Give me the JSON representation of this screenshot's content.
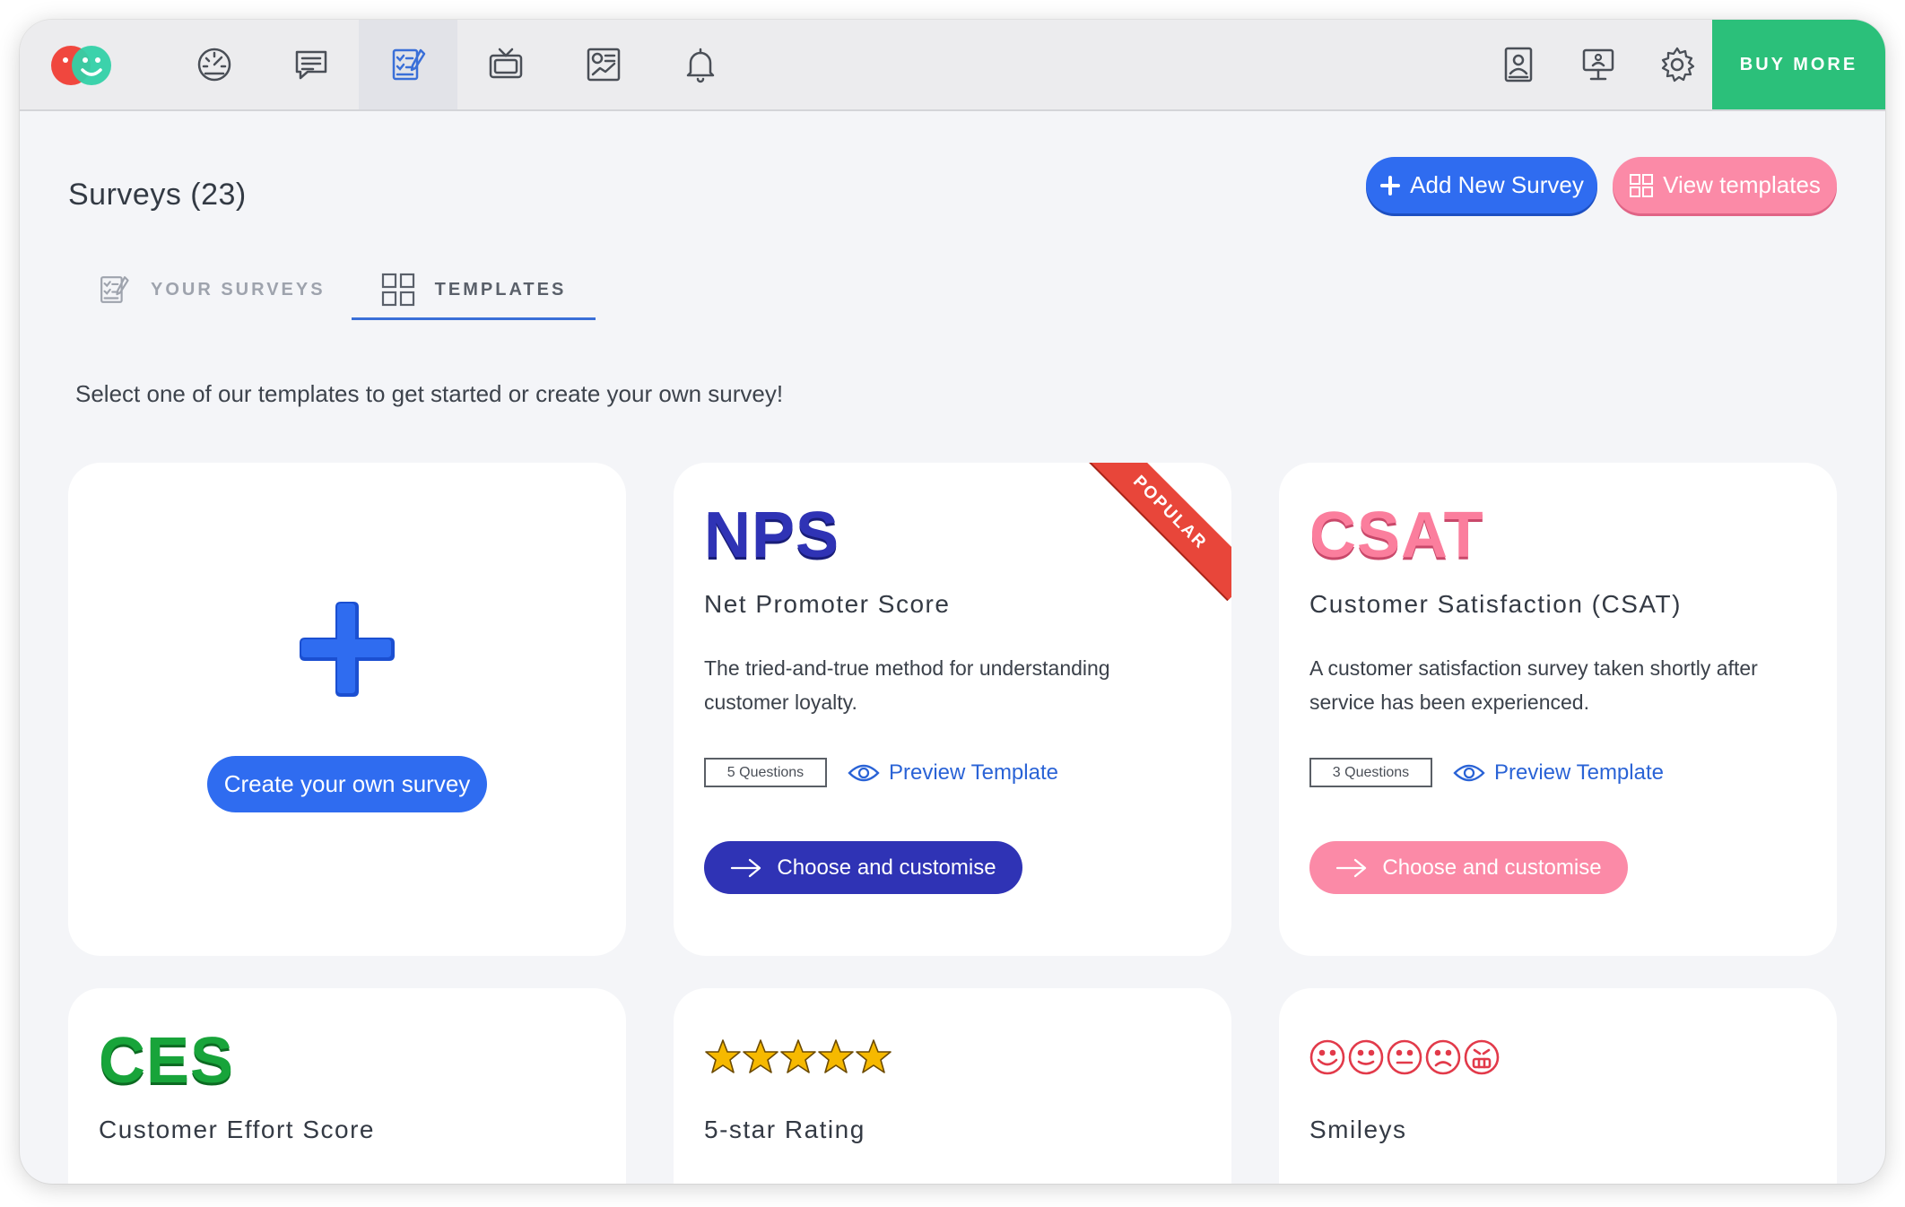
{
  "topbar": {
    "nav_icons": [
      "dashboard-icon",
      "feedback-icon",
      "surveys-icon",
      "tv-display-icon",
      "reports-icon",
      "notifications-icon"
    ],
    "right_icons": [
      "contacts-icon",
      "kiosk-icon",
      "settings-icon"
    ],
    "buy_more_label": "BUY MORE",
    "accent": "#2bc07a"
  },
  "header": {
    "title": "Surveys (23)",
    "add_button_label": "Add New Survey",
    "view_templates_label": "View templates"
  },
  "tabs": [
    {
      "label": "YOUR SURVEYS",
      "active": false
    },
    {
      "label": "TEMPLATES",
      "active": true
    }
  ],
  "intro_text": "Select one of our templates to get started or create your own survey!",
  "create_card": {
    "button_label": "Create your own survey"
  },
  "templates": [
    {
      "logo": "NPS",
      "title": "Net Promoter Score",
      "description": "The tried-and-true method for understanding customer loyalty.",
      "questions": "5 Questions",
      "preview_label": "Preview Template",
      "choose_label": "Choose and customise",
      "ribbon": "POPULAR",
      "color": "#2f33b5"
    },
    {
      "logo": "CSAT",
      "title": "Customer Satisfaction (CSAT)",
      "description": "A customer satisfaction survey taken shortly after service has been experienced.",
      "questions": "3 Questions",
      "preview_label": "Preview Template",
      "choose_label": "Choose and customise",
      "color": "#fb8aa7"
    },
    {
      "logo": "CES",
      "title": "Customer Effort Score",
      "color": "#18a43a"
    },
    {
      "logo_icon": "five-stars-icon",
      "title": "5-star Rating",
      "color": "#f5b400"
    },
    {
      "logo_icon": "smileys-icon",
      "title": "Smileys",
      "color": "#e23a4a"
    }
  ]
}
